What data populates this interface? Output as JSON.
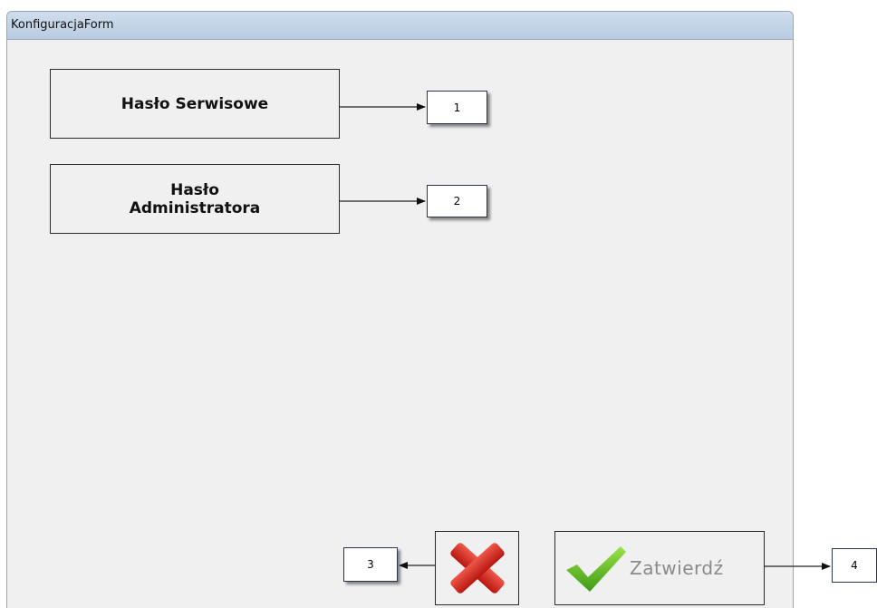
{
  "window": {
    "title": "KonfiguracjaForm"
  },
  "buttons": {
    "service_password": "Hasło Serwisowe",
    "admin_password_line1": "Hasło",
    "admin_password_line2": "Administratora",
    "confirm": "Zatwierdź",
    "cancel_icon": "red-x-icon",
    "confirm_icon": "green-check-icon"
  },
  "callouts": [
    "1",
    "2",
    "3",
    "4"
  ],
  "colors": {
    "titlebar": "#c4d4e8",
    "cancel_icon": "#d42a20",
    "confirm_icon": "#6cc12a",
    "confirm_text": "#8a8a8a"
  }
}
